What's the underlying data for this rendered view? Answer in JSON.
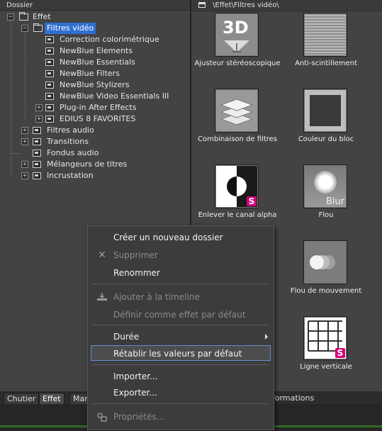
{
  "left_panel": {
    "header": "Dossier",
    "tree": [
      {
        "label": "Effet"
      },
      {
        "label": "Filtres vidéo"
      },
      {
        "label": "Correction colorimétrique"
      },
      {
        "label": "NewBlue Elements"
      },
      {
        "label": "NewBlue Essentials"
      },
      {
        "label": "NewBlue Filters"
      },
      {
        "label": "NewBlue Stylizers"
      },
      {
        "label": "NewBlue Video Essentials III"
      },
      {
        "label": "Plug-in After Effects"
      },
      {
        "label": "EDIUS 8 FAVORITES"
      },
      {
        "label": "Filtres audio"
      },
      {
        "label": "Transitions"
      },
      {
        "label": "Fondus audio"
      },
      {
        "label": "Mélangeurs de titres"
      },
      {
        "label": "Incrustation"
      }
    ]
  },
  "right_panel": {
    "path": "\\Effet\\Filtres vidéo\\",
    "effects": [
      {
        "label": "Ajusteur stéréoscopique",
        "thumb_text": "3D"
      },
      {
        "label": "Anti-scintillement"
      },
      {
        "label": "Combinaison de filtres"
      },
      {
        "label": "Couleur du bloc"
      },
      {
        "label": "Enlever le canal alpha",
        "badge": "S"
      },
      {
        "label": "Flou",
        "thumb_text": "Blur"
      },
      {
        "label": "Flou de mouvement"
      },
      {
        "label": "Ligne verticale",
        "badge": "S"
      }
    ]
  },
  "tabs": {
    "chutier": "Chutier",
    "effet": "Effet",
    "marqueur": "Marq",
    "informations": "formations"
  },
  "context_menu": {
    "create_folder": "Créer un nouveau dossier",
    "delete": "Supprimer",
    "rename": "Renommer",
    "add_to_timeline": "Ajouter à la timeline",
    "set_default": "Définir comme effet par défaut",
    "duration": "Durée",
    "restore_defaults": "Rétablir les valeurs par défaut",
    "import": "Importer...",
    "export": "Exporter...",
    "properties": "Propriétés..."
  },
  "colors": {
    "selection": "#2f6fd0",
    "badge": "#d2007a",
    "accent_line": "#2f6b22"
  }
}
